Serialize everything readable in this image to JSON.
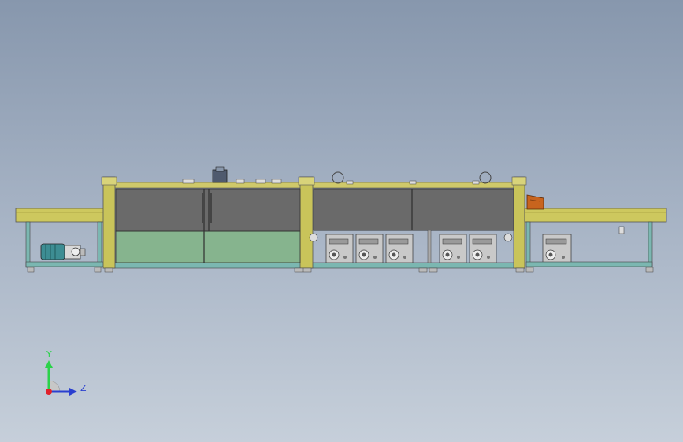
{
  "viewport": {
    "background_top": "#8797ad",
    "background_bottom": "#c6cfda"
  },
  "colors": {
    "frame_yellow": "#c9c45a",
    "frame_yellow_dark": "#8f8a2e",
    "base_teal": "#76b3ad",
    "chamber_gray": "#6a6a6a",
    "lower_green": "#86b48e",
    "motor_teal": "#3d8d93",
    "pump_gray": "#c9c9c9",
    "orange_box": "#c8641e"
  },
  "triad": {
    "y_label": "Y",
    "z_label": "Z",
    "y_color": "#2bd24a",
    "z_color": "#2a3fd0",
    "x_color": "#e0202a"
  }
}
